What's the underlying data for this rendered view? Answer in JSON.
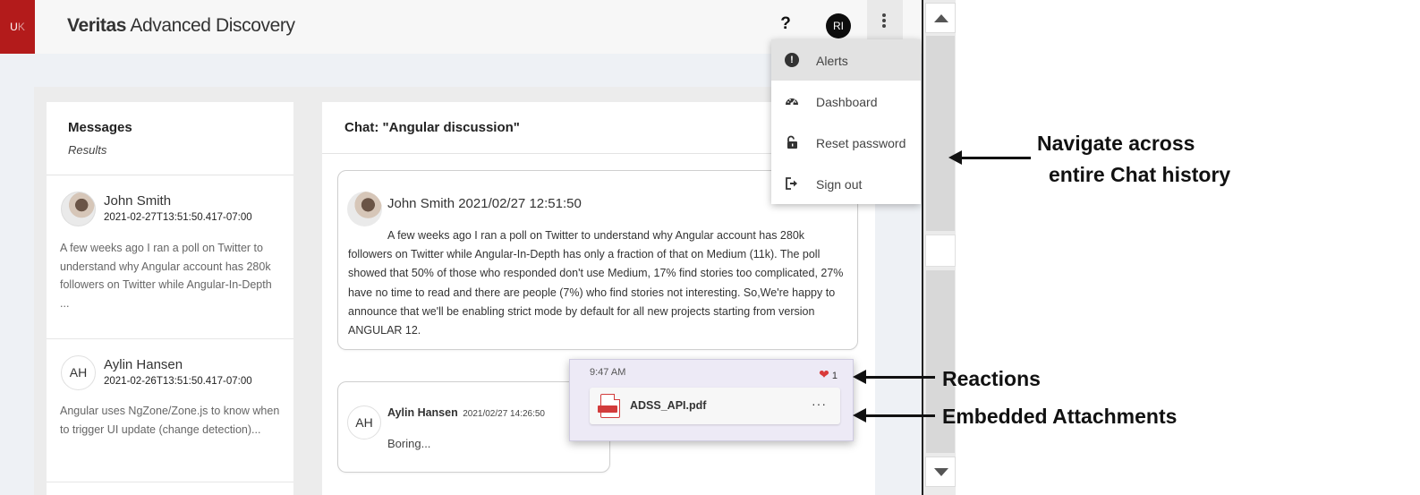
{
  "header": {
    "logo_text": "U",
    "logo_text_faded": "K",
    "title_bold": "Veritas",
    "title_rest": " Advanced Discovery",
    "help_label": "?",
    "user_initials": "RI"
  },
  "menu": {
    "items": [
      {
        "label": "Alerts",
        "icon": "alert-icon"
      },
      {
        "label": "Dashboard",
        "icon": "dashboard-icon"
      },
      {
        "label": "Reset password",
        "icon": "unlock-icon"
      },
      {
        "label": "Sign out",
        "icon": "sign-out-icon"
      }
    ]
  },
  "messages": {
    "title": "Messages",
    "subtitle": "Results",
    "items": [
      {
        "name": "John Smith",
        "timestamp": "2021-02-27T13:51:50.417-07:00",
        "preview": "A few weeks ago I ran a poll on Twitter to understand why Angular account has 280k followers on Twitter while Angular-In-Depth ..."
      },
      {
        "name": "Aylin Hansen",
        "initials": "AH",
        "timestamp": "2021-02-26T13:51:50.417-07:00",
        "preview": "Angular uses NgZone/Zone.js to know when to trigger UI update (change detection)..."
      }
    ]
  },
  "chat": {
    "title": "Chat: \"Angular discussion\"",
    "messages": [
      {
        "header": "John Smith 2021/02/27 12:51:50",
        "text": "A few weeks ago I ran a poll on Twitter to understand why Angular account has 280k followers on Twitter while Angular-In-Depth has only a fraction of that on Medium (11k). The poll showed that 50% of those who responded don't use Medium, 17% find stories too complicated, 27% have no time to read and there are people (7%) who find stories not interesting. So,We're happy to announce that we'll be enabling strict mode by default for all new projects starting from version ANGULAR 12."
      },
      {
        "initials": "AH",
        "name": "Aylin Hansen",
        "time": "2021/02/27 14:26:50",
        "text": "Boring..."
      }
    ],
    "attachment_card": {
      "time": "9:47 AM",
      "reaction_icon": "heart-icon",
      "reaction_count": "1",
      "file_name": "ADSS_API.pdf",
      "file_icon": "pdf-icon",
      "more_label": "···"
    }
  },
  "annotations": {
    "history_line1": "Navigate across",
    "history_line2": "entire Chat history",
    "reactions": "Reactions",
    "attachments": "Embedded Attachments"
  }
}
